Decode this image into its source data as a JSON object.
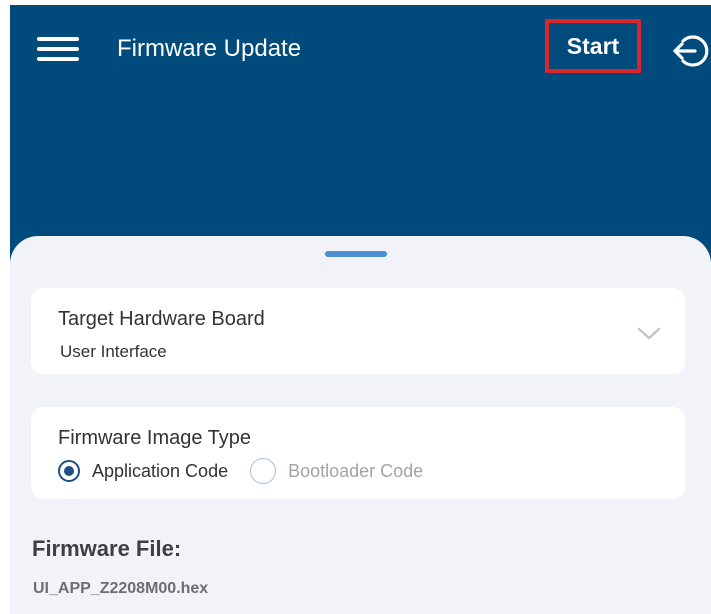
{
  "header": {
    "title": "Firmware Update",
    "start_label": "Start",
    "menu_icon": "hamburger-menu-icon",
    "logout_icon": "logout-icon",
    "background_color": "#004a7c",
    "highlight_color": "#d9262e"
  },
  "board": {
    "label": "Target Hardware Board",
    "value": "User Interface",
    "dropdown_icon": "chevron-down-icon"
  },
  "image_type": {
    "label": "Firmware Image Type",
    "options": [
      {
        "label": "Application Code",
        "selected": true
      },
      {
        "label": "Bootloader Code",
        "selected": false
      }
    ]
  },
  "firmware_file": {
    "heading": "Firmware File:",
    "file_name": "UI_APP_Z2208M00.hex"
  }
}
